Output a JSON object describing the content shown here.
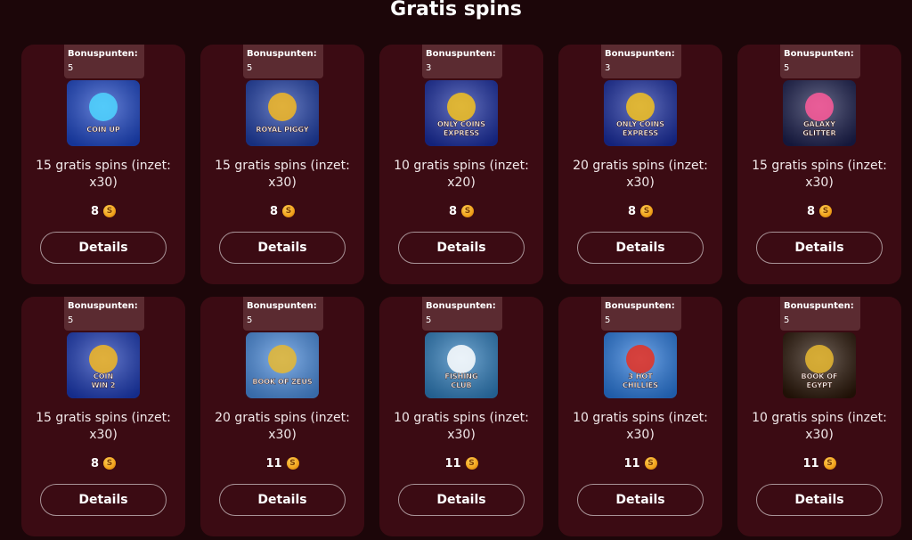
{
  "page": {
    "title": "Gratis spins"
  },
  "cards": [
    {
      "bonus_label": "Bonuspunten:",
      "bonus_value": "5",
      "offer": "15 gratis spins (inzet: x30)",
      "cost": "8",
      "button": "Details",
      "game_icon": "coin-up-thumbnail",
      "colors": {
        "bg": "#1d47c9",
        "accent": "#4fd6ff"
      },
      "logo_lines": [
        "COIN UP"
      ]
    },
    {
      "bonus_label": "Bonuspunten:",
      "bonus_value": "5",
      "offer": "15 gratis spins (inzet: x30)",
      "cost": "8",
      "button": "Details",
      "game_icon": "royal-piggy-thumbnail",
      "colors": {
        "bg": "#1f3fa8",
        "accent": "#f5b822"
      },
      "logo_lines": [
        "ROYAL PIGGY"
      ]
    },
    {
      "bonus_label": "Bonuspunten:",
      "bonus_value": "3",
      "offer": "10 gratis spins (inzet: x20)",
      "cost": "8",
      "button": "Details",
      "game_icon": "only-coins-express-thumbnail",
      "colors": {
        "bg": "#1a2ea3",
        "accent": "#f5c21f"
      },
      "logo_lines": [
        "ONLY COINS",
        "EXPRESS"
      ]
    },
    {
      "bonus_label": "Bonuspunten:",
      "bonus_value": "3",
      "offer": "20 gratis spins (inzet: x30)",
      "cost": "8",
      "button": "Details",
      "game_icon": "only-coins-express-thumbnail",
      "colors": {
        "bg": "#1a2ea3",
        "accent": "#f5c21f"
      },
      "logo_lines": [
        "ONLY COINS",
        "EXPRESS"
      ]
    },
    {
      "bonus_label": "Bonuspunten:",
      "bonus_value": "5",
      "offer": "15 gratis spins (inzet: x30)",
      "cost": "8",
      "button": "Details",
      "game_icon": "galaxy-glitter-thumbnail",
      "colors": {
        "bg": "#1b1f4e",
        "accent": "#ff5a9a"
      },
      "logo_lines": [
        "GALAXY",
        "GLITTER"
      ]
    },
    {
      "bonus_label": "Bonuspunten:",
      "bonus_value": "5",
      "offer": "15 gratis spins (inzet: x30)",
      "cost": "8",
      "button": "Details",
      "game_icon": "coin-win-2-thumbnail",
      "colors": {
        "bg": "#1c3bb8",
        "accent": "#f5b822"
      },
      "logo_lines": [
        "COIN",
        "WIN 2"
      ]
    },
    {
      "bonus_label": "Bonuspunten:",
      "bonus_value": "5",
      "offer": "20 gratis spins (inzet: x30)",
      "cost": "11",
      "button": "Details",
      "game_icon": "book-of-zeus-thumbnail",
      "colors": {
        "bg": "#4a8de0",
        "accent": "#e8b830"
      },
      "logo_lines": [
        "BOOK OF ZEUS"
      ]
    },
    {
      "bonus_label": "Bonuspunten:",
      "bonus_value": "5",
      "offer": "10 gratis spins (inzet: x30)",
      "cost": "11",
      "button": "Details",
      "game_icon": "fishing-club-thumbnail",
      "colors": {
        "bg": "#2f7fbf",
        "accent": "#ffffff"
      },
      "logo_lines": [
        "FISHING",
        "CLUB"
      ]
    },
    {
      "bonus_label": "Bonuspunten:",
      "bonus_value": "5",
      "offer": "10 gratis spins (inzet: x30)",
      "cost": "11",
      "button": "Details",
      "game_icon": "3-hot-chillies-thumbnail",
      "colors": {
        "bg": "#2a7be0",
        "accent": "#e83020"
      },
      "logo_lines": [
        "3 HOT",
        "CHILLIES"
      ]
    },
    {
      "bonus_label": "Bonuspunten:",
      "bonus_value": "5",
      "offer": "10 gratis spins (inzet: x30)",
      "cost": "11",
      "button": "Details",
      "game_icon": "book-of-egypt-thumbnail",
      "colors": {
        "bg": "#2a1608",
        "accent": "#e8b830"
      },
      "logo_lines": [
        "BOOK OF",
        "EGYPT"
      ]
    }
  ],
  "coin_icon": "bonus-coin-icon"
}
